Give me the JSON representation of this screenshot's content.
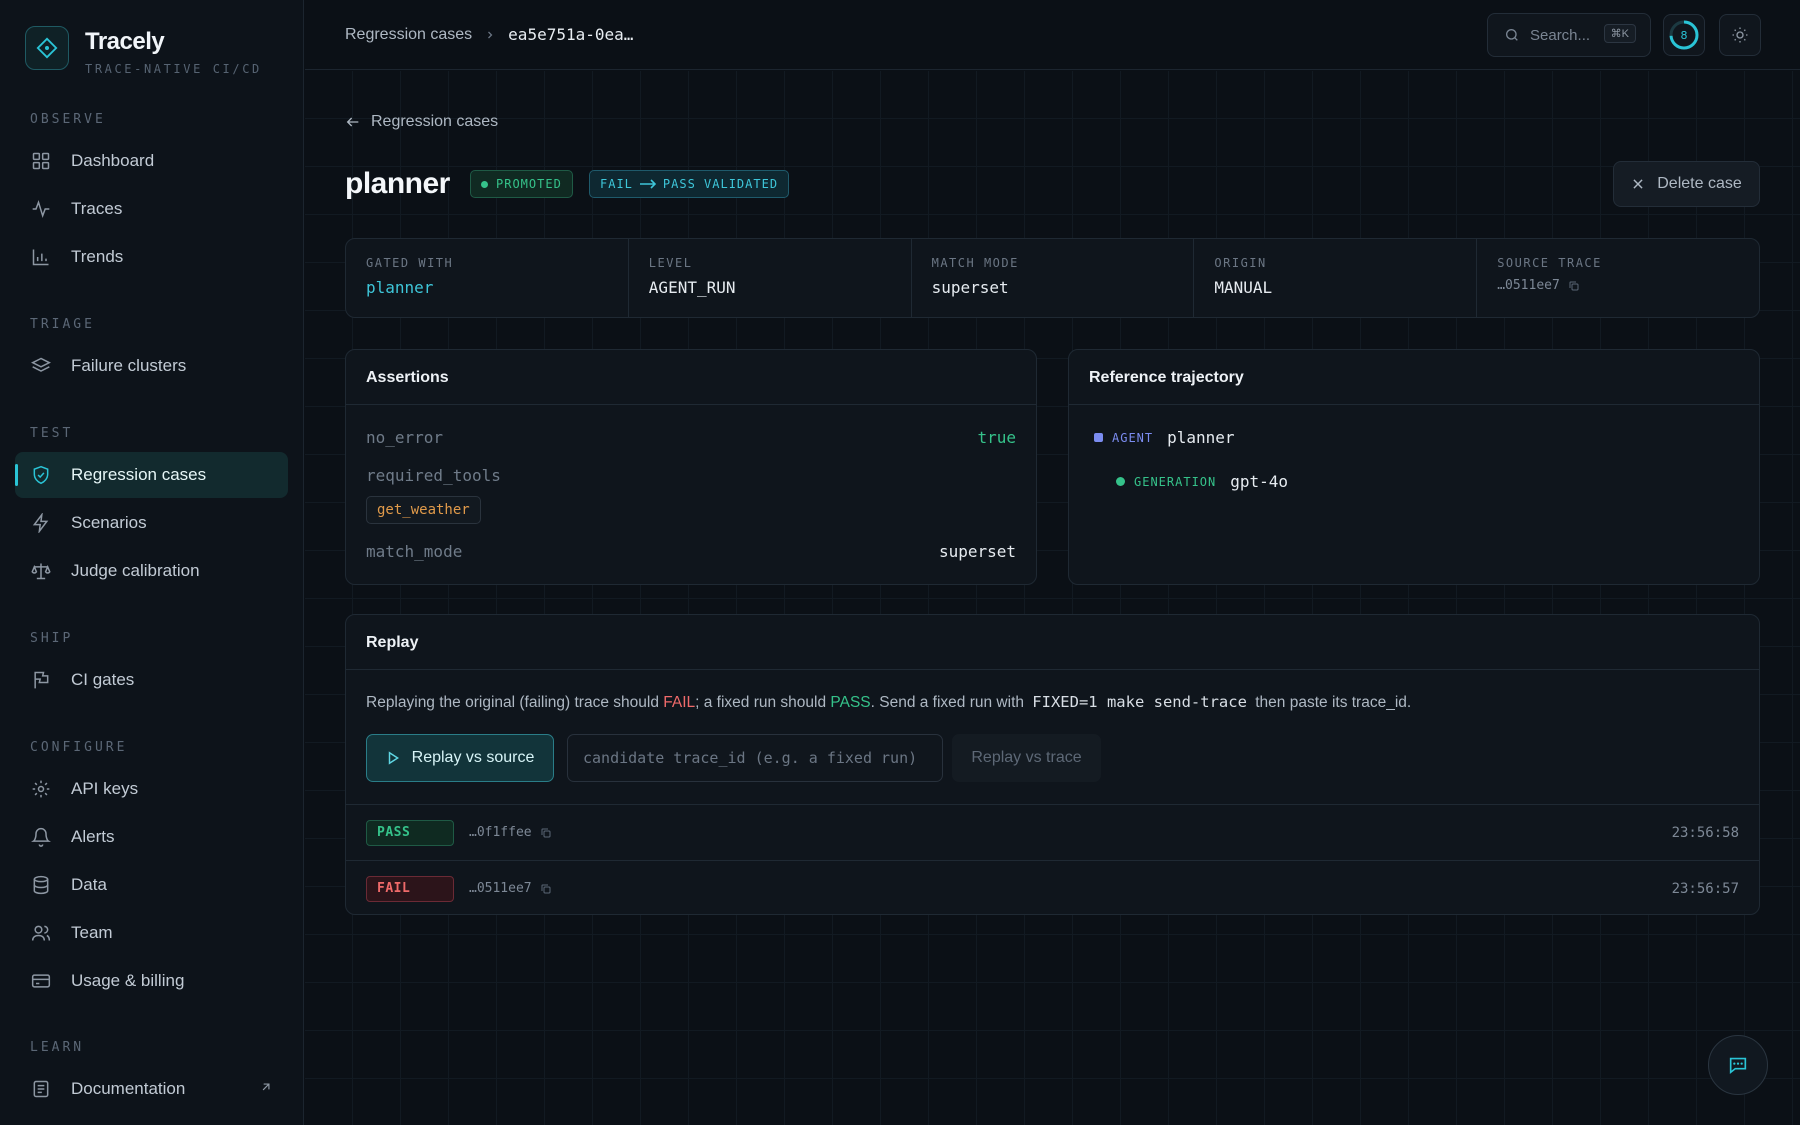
{
  "brand": {
    "name": "Tracely",
    "tagline": "TRACE-NATIVE CI/CD"
  },
  "sidebar": {
    "sections": [
      {
        "title": "OBSERVE",
        "items": [
          {
            "label": "Dashboard",
            "icon": "grid-icon"
          },
          {
            "label": "Traces",
            "icon": "activity-icon"
          },
          {
            "label": "Trends",
            "icon": "bar-chart-icon"
          }
        ]
      },
      {
        "title": "TRIAGE",
        "items": [
          {
            "label": "Failure clusters",
            "icon": "layers-icon"
          }
        ]
      },
      {
        "title": "TEST",
        "items": [
          {
            "label": "Regression cases",
            "icon": "shield-check-icon",
            "active": true
          },
          {
            "label": "Scenarios",
            "icon": "bolt-icon"
          },
          {
            "label": "Judge calibration",
            "icon": "scale-icon"
          }
        ]
      },
      {
        "title": "SHIP",
        "items": [
          {
            "label": "CI gates",
            "icon": "flag-icon"
          }
        ]
      },
      {
        "title": "CONFIGURE",
        "items": [
          {
            "label": "API keys",
            "icon": "gear-icon"
          },
          {
            "label": "Alerts",
            "icon": "bell-icon"
          },
          {
            "label": "Data",
            "icon": "database-icon"
          },
          {
            "label": "Team",
            "icon": "users-icon"
          },
          {
            "label": "Usage & billing",
            "icon": "credit-card-icon"
          }
        ]
      },
      {
        "title": "LEARN",
        "items": [
          {
            "label": "Documentation",
            "icon": "book-icon",
            "external": true
          }
        ]
      }
    ]
  },
  "topbar": {
    "breadcrumb": [
      "Regression cases",
      "ea5e751a-0ea…"
    ],
    "search_placeholder": "Search...",
    "search_shortcut": "⌘K",
    "notification_count": "8"
  },
  "page": {
    "back_label": "Regression cases",
    "title": "planner",
    "badges": {
      "promoted": "PROMOTED",
      "validated_from": "FAIL",
      "validated_to": "PASS VALIDATED"
    },
    "delete_label": "Delete case"
  },
  "meta": [
    {
      "label": "GATED WITH",
      "value": "planner"
    },
    {
      "label": "LEVEL",
      "value": "AGENT_RUN"
    },
    {
      "label": "MATCH MODE",
      "value": "superset"
    },
    {
      "label": "ORIGIN",
      "value": "MANUAL"
    },
    {
      "label": "SOURCE TRACE",
      "value": "…0511ee7"
    }
  ],
  "assertions": {
    "title": "Assertions",
    "no_error_key": "no_error",
    "no_error_value": "true",
    "required_tools_key": "required_tools",
    "required_tools": [
      "get_weather"
    ],
    "match_mode_key": "match_mode",
    "match_mode_value": "superset"
  },
  "trajectory": {
    "title": "Reference trajectory",
    "steps": [
      {
        "type": "AGENT",
        "name": "planner",
        "color": "#7b8cf0"
      },
      {
        "type": "GENERATION",
        "name": "gpt-4o",
        "color": "#35c28a"
      }
    ]
  },
  "replay": {
    "title": "Replay",
    "desc_1": "Replaying the original (failing) trace should ",
    "desc_fail": "FAIL",
    "desc_2": "; a fixed run should ",
    "desc_pass": "PASS",
    "desc_3": ". Send a fixed run with ",
    "desc_code": "FIXED=1 make send-trace",
    "desc_4": " then paste its trace_id.",
    "replay_source_label": "Replay vs source",
    "candidate_placeholder": "candidate trace_id (e.g. a fixed run)",
    "replay_trace_label": "Replay vs trace",
    "results": [
      {
        "status": "PASS",
        "trace": "…0f1ffee",
        "time": "23:56:58"
      },
      {
        "status": "FAIL",
        "trace": "…0511ee7",
        "time": "23:56:57"
      }
    ]
  }
}
